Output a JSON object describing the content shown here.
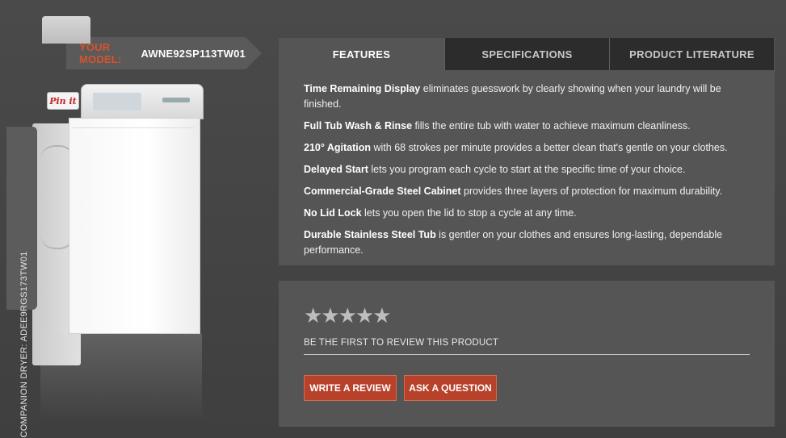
{
  "model": {
    "prefix": "YOUR MODEL:",
    "value": "AWNE92SP113TW01"
  },
  "companion": {
    "label": "COMPANION DRYER: ADEE9RGS173TW01"
  },
  "pinit": {
    "label": "Pin it"
  },
  "tabs": [
    {
      "label": "FEATURES",
      "active": true
    },
    {
      "label": "SPECIFICATIONS",
      "active": false
    },
    {
      "label": "PRODUCT LITERATURE",
      "active": false
    }
  ],
  "features": [
    {
      "lead": "Time Remaining Display",
      "text": " eliminates guesswork by clearly showing when your laundry will be finished."
    },
    {
      "lead": "Full Tub Wash & Rinse",
      "text": " fills the entire tub with water to achieve maximum cleanliness."
    },
    {
      "lead": "210° Agitation",
      "text": " with 68 strokes per minute provides a better clean that's gentle on your clothes."
    },
    {
      "lead": "Delayed Start",
      "text": " lets you program each cycle to start at the specific time of your choice."
    },
    {
      "lead": "Commercial-Grade Steel Cabinet",
      "text": " provides three layers of protection for maximum durability."
    },
    {
      "lead": "No Lid Lock",
      "text": " lets you open the lid to stop a cycle at any time."
    },
    {
      "lead": "Durable Stainless Steel Tub",
      "text": " is gentler on your clothes and ensures long-lasting, dependable performance."
    }
  ],
  "review": {
    "stars": "★★★★★",
    "rating": 0,
    "prompt": "BE THE FIRST TO REVIEW THIS PRODUCT",
    "write_label": "WRITE A REVIEW",
    "ask_label": "ASK A QUESTION"
  },
  "colors": {
    "accent": "#d8532a",
    "button": "#b8412a",
    "panel": "#555555",
    "tab_inactive": "#2c2c2c"
  }
}
